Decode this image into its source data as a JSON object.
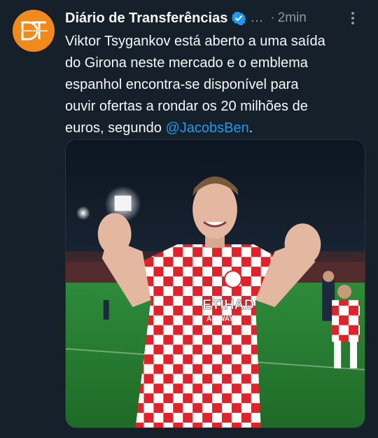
{
  "author": {
    "display_name": "Diário de Transferências",
    "handle_truncated": "…",
    "separator": "·",
    "time": "2min",
    "avatar_icon": "dt-logo-icon",
    "avatar_text": "DT",
    "verified_icon": "verified-badge-icon",
    "accent_color": "#f08a1c"
  },
  "tweet": {
    "lines": [
      "Viktor Tsygankov está aberto a uma saída",
      "do Girona neste mercado e o emblema",
      "espanhol encontra-se disponível para",
      "ouvir ofertas a rondar os 20 milhões de"
    ],
    "last_line_prefix": "euros, segundo ",
    "mention": "@JacobsBen",
    "last_line_suffix": ".",
    "mention_color": "#1d9bf0"
  },
  "media": {
    "kind": "photo",
    "jersey_sponsor": "ETIHAD",
    "jersey_sponsor_sub": "AIRWAYS",
    "subject": "footballer-celebrating-photo"
  },
  "actions": {
    "more_icon": "more-options-icon"
  }
}
